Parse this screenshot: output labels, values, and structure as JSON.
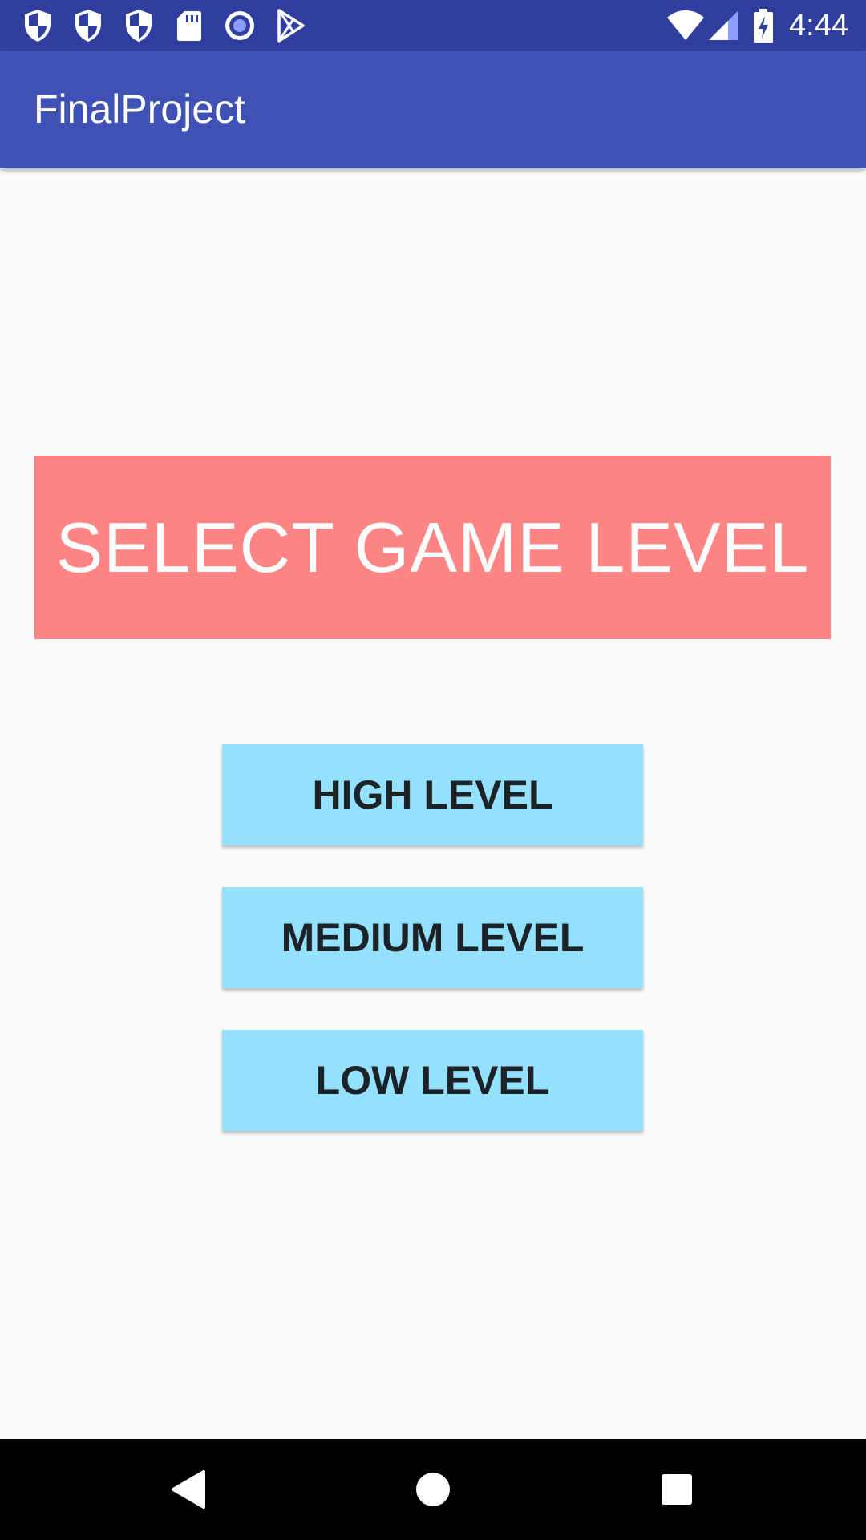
{
  "status_bar": {
    "time": "4:44",
    "left_icons": [
      "shield-icon",
      "shield-icon",
      "shield-icon",
      "sd-card-icon",
      "record-icon",
      "play-store-icon"
    ],
    "right_icons": [
      "wifi-icon",
      "cellular-signal-icon",
      "battery-charging-icon"
    ],
    "color": "#303f9f"
  },
  "app_bar": {
    "title": "FinalProject",
    "color": "#3f51b5"
  },
  "header": {
    "text": "SELECT GAME LEVEL",
    "background": "#ff8484"
  },
  "buttons": {
    "high": "HIGH LEVEL",
    "medium": "MEDIUM LEVEL",
    "low": "LOW LEVEL",
    "background": "#94e1fd"
  },
  "nav_bar": {
    "icons": [
      "back-icon",
      "home-icon",
      "recents-icon"
    ]
  }
}
